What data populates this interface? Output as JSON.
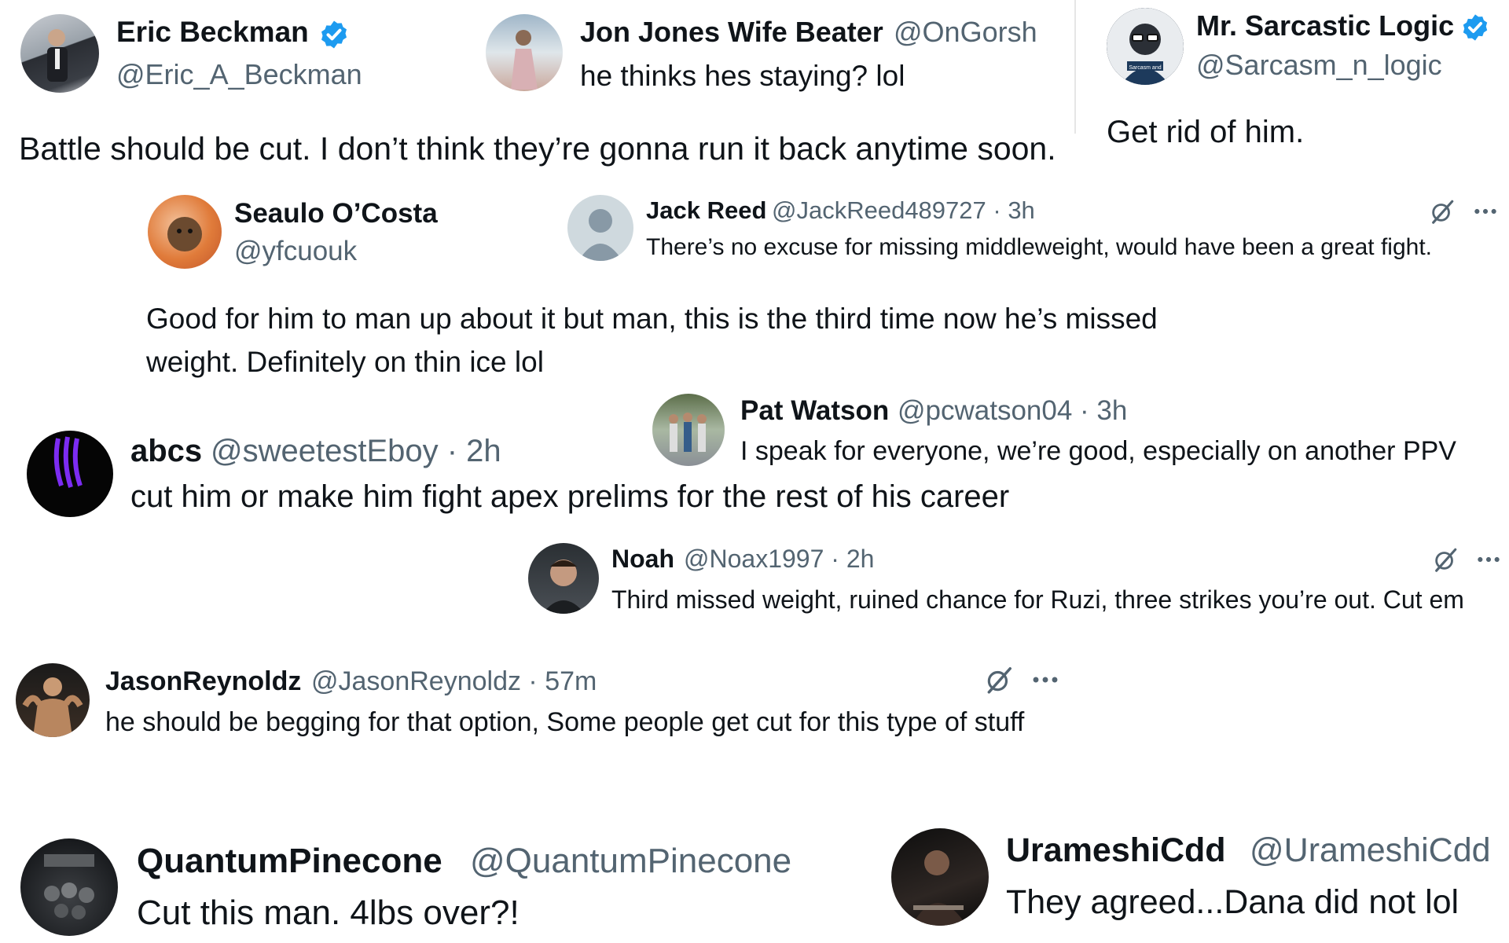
{
  "colors": {
    "text": "#0f1419",
    "muted": "#536471",
    "verified": "#1d9bf0",
    "background": "#ffffff"
  },
  "icons": {
    "verified": "verified-badge-icon",
    "grok": "grok-icon",
    "more": "more-options-icon"
  },
  "replies": [
    {
      "name": "Eric Beckman",
      "handle": "@Eric_A_Beckman",
      "verified": true,
      "text": "Battle should be cut. I don’t think they’re gonna run it back anytime soon."
    },
    {
      "name": "Jon Jones Wife Beater",
      "handle": "@OnGorsh",
      "text": "he thinks hes staying? lol"
    },
    {
      "name": "Mr. Sarcastic Logic",
      "handle": "@Sarcasm_n_logic",
      "verified": true,
      "text": "Get rid of him.",
      "avatar_caption": "Sarcasm and"
    },
    {
      "name": "Seaulo O’Costa",
      "handle": "@yfcuouk",
      "text": "Good for him to man up about it but man, this is the third time now he’s missed weight. Definitely on thin ice lol"
    },
    {
      "name": "Jack Reed",
      "handle": "@JackReed489727 · 3h",
      "text": "There’s no excuse for missing middleweight, would have been a great fight."
    },
    {
      "name": "Pat Watson",
      "handle": "@pcwatson04 · 3h",
      "text": "I speak for everyone, we’re good, especially on another PPV"
    },
    {
      "name": "abcs",
      "handle": "@sweetestEboy · 2h",
      "text": "cut him or make him fight apex prelims for the rest of his career"
    },
    {
      "name": "Noah",
      "handle": "@Noax1997 · 2h",
      "text": "Third missed weight, ruined chance for Ruzi, three strikes you’re out. Cut em"
    },
    {
      "name": "JasonReynoldz",
      "handle": "@JasonReynoldz · 57m",
      "text": "he should be begging for that option, Some people get cut for this type of stuff"
    },
    {
      "name": "QuantumPinecone",
      "handle": "@QuantumPinecone",
      "text": "Cut this man. 4lbs over?!"
    },
    {
      "name": "UrameshiCdd",
      "handle": "@UrameshiCdd",
      "text": "They agreed...Dana did not lol"
    }
  ]
}
